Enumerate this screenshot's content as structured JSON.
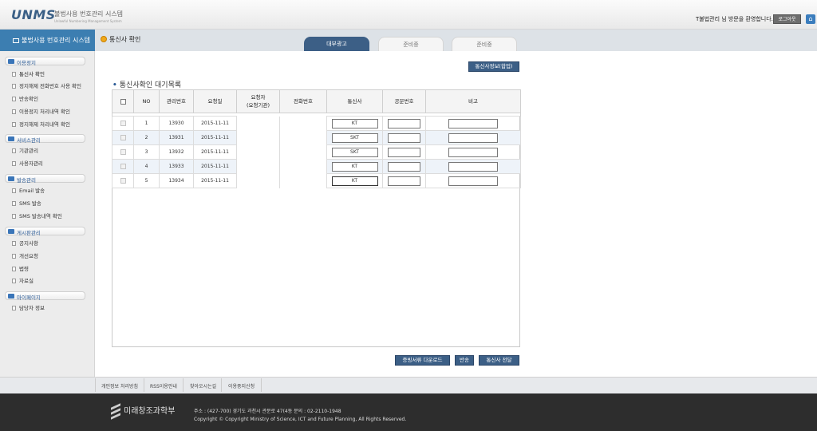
{
  "header": {
    "logo": "UNMS",
    "system_name": "불법사용 번호관리 시스템",
    "system_name_en": "Unlawful Numbering Management System",
    "welcome": "T불법관리 님 방문을 환영합니다.",
    "logout": "로그아웃",
    "home_icon": "home-icon"
  },
  "subheader": {
    "system_bar": "불법사용 번호관리 시스템",
    "page_title": "통신사 확인",
    "tabs": [
      {
        "label": "대부광고",
        "active": true
      },
      {
        "label": "준비중",
        "active": false
      },
      {
        "label": "준비중",
        "active": false
      }
    ]
  },
  "sidebar": {
    "groups": [
      {
        "label": "이용정지",
        "items": [
          "통신사 확인",
          "정지해제 전화번호 사용 확인",
          "반송확인",
          "이용정지 처리내역 확인",
          "정지해제 처리내역 확인"
        ]
      },
      {
        "label": "서비스관리",
        "items": [
          "기관관리",
          "사용자관리"
        ]
      },
      {
        "label": "발송관리",
        "items": [
          "Email 발송",
          "SMS 발송",
          "SMS 발송내역 확인"
        ]
      },
      {
        "label": "게시판관리",
        "items": [
          "공지사항",
          "개선요청",
          "법령",
          "자료실"
        ]
      },
      {
        "label": "마이페이지",
        "items": [
          "담당자 정보"
        ]
      }
    ]
  },
  "main": {
    "carrier_info_button": "통신사정보(합업)",
    "list_title": "통신사확인 대기목록",
    "columns": [
      "NO",
      "관리번호",
      "요청일",
      "요청자",
      "(요청기관)",
      "전화번호",
      "통신사",
      "공문번호",
      "비고"
    ],
    "rows": [
      {
        "no": "1",
        "mgmt": "13930",
        "date": "2015-11-11",
        "carrier": "KT"
      },
      {
        "no": "2",
        "mgmt": "13931",
        "date": "2015-11-11",
        "carrier": "SKT"
      },
      {
        "no": "3",
        "mgmt": "13932",
        "date": "2015-11-11",
        "carrier": "SKT"
      },
      {
        "no": "4",
        "mgmt": "13933",
        "date": "2015-11-11",
        "carrier": "KT"
      },
      {
        "no": "5",
        "mgmt": "13934",
        "date": "2015-11-11",
        "carrier": "KT"
      }
    ],
    "buttons": {
      "download": "증빙서류 다운로드",
      "return": "반송",
      "forward": "통신사 전달"
    }
  },
  "footer": {
    "links": [
      "개인정보 처리방침",
      "RSS이용안내",
      "찾아오시는길",
      "이용중지신청"
    ],
    "ministry": "미래창조과학부",
    "address": "주소 : (427-700) 경기도 과천시 관문로 47(4동      문의 : 02-2110-1948",
    "copyright": "Copyright © Copyright Ministry of Science, ICT and Future Planning, All Rights Reserved."
  }
}
